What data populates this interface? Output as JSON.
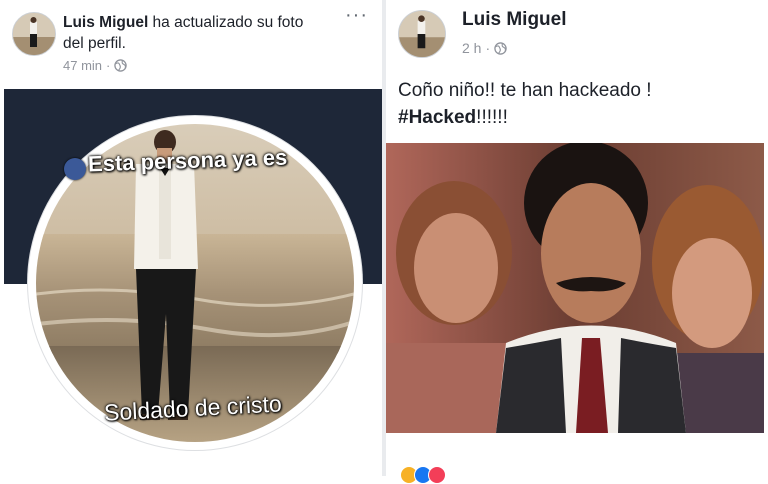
{
  "left_post": {
    "author": "Luis Miguel",
    "action_text": " ha actualizado su foto",
    "action_text_line2": "del perfil.",
    "timestamp": "47 min",
    "separator": "·",
    "more_label": "···",
    "profile_overlay_top": "Esta persona ya es",
    "profile_overlay_bottom": "Soldado de cristo"
  },
  "right_post": {
    "author": "Luis Miguel",
    "timestamp": "2 h",
    "separator": "·",
    "text_line1": "Coño niño!! te han hackeado !",
    "hashtag": "#Hacked",
    "text_suffix": "!!!!!!"
  },
  "colors": {
    "cover_background": "#1e2738",
    "author_text": "#1d2129",
    "meta_text": "#90949c",
    "page_divider": "#e9ebee"
  },
  "icons": {
    "privacy": "globe-icon",
    "more": "more-options-icon"
  }
}
